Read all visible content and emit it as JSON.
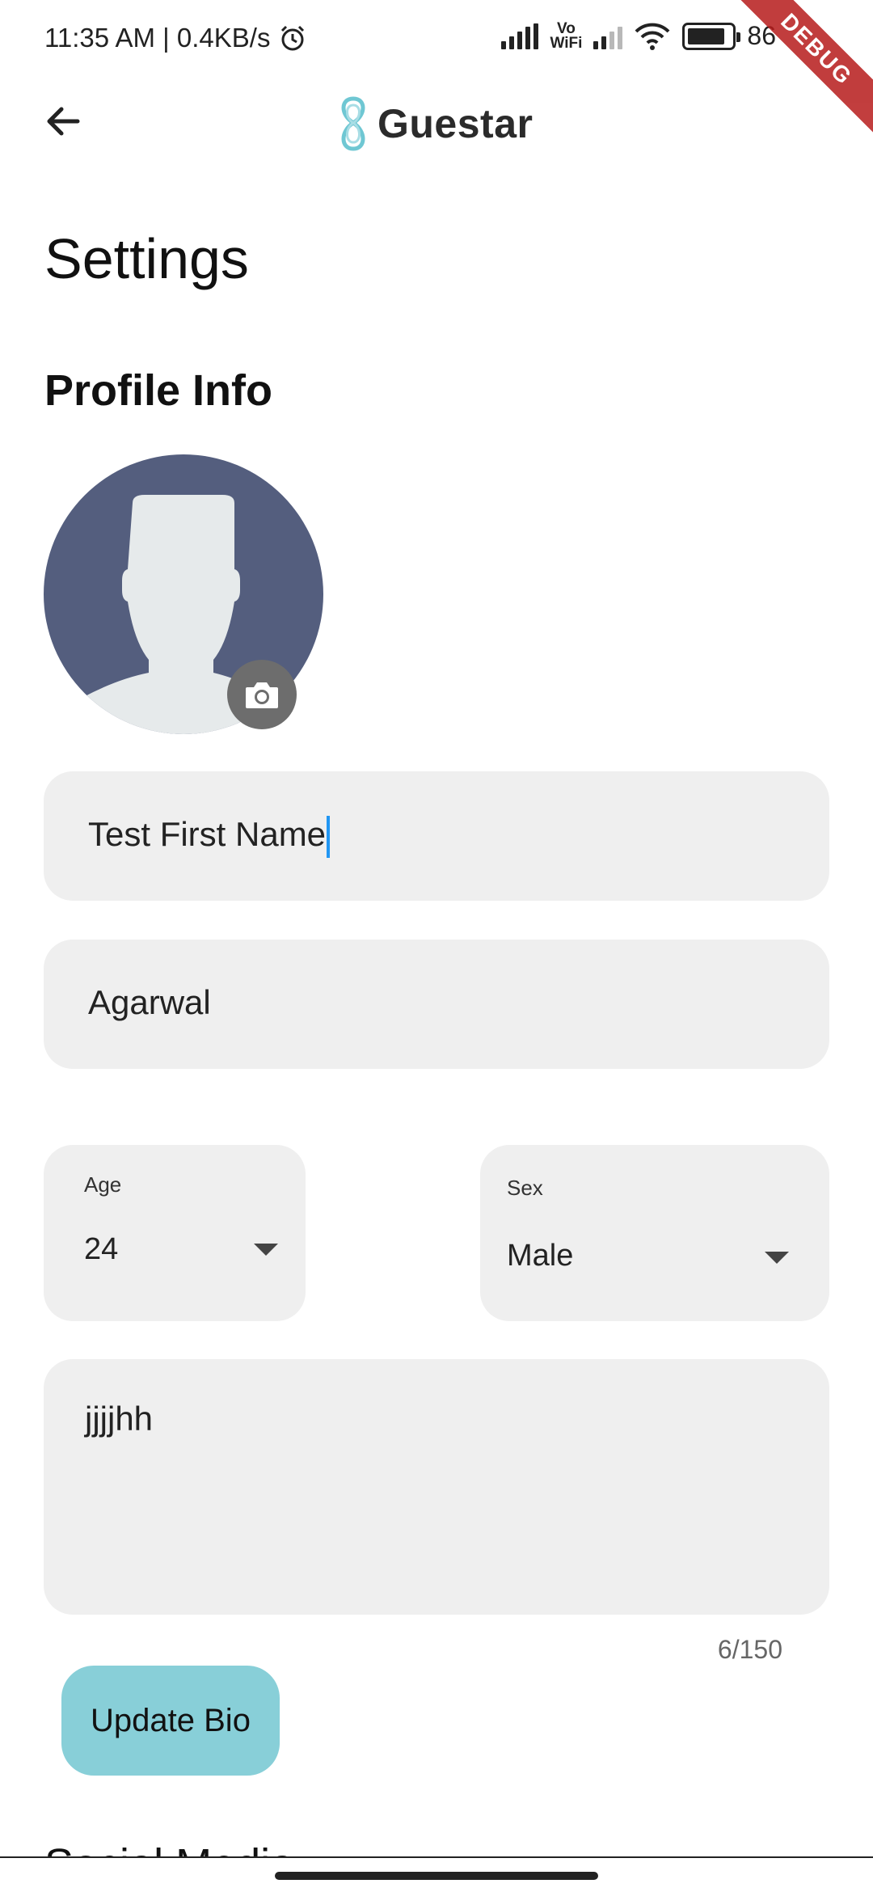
{
  "status_bar": {
    "time": "11:35 AM | 0.4KB/s",
    "vowifi_top": "Vo",
    "vowifi_bottom": "WiFi",
    "battery": "86",
    "battery_level": 0.86,
    "debug_label": "DEBUG"
  },
  "app_bar": {
    "brand": "Guestar",
    "brand_color": "#6fc7d3",
    "back_icon": "arrow-left-icon"
  },
  "page": {
    "title": "Settings",
    "section_profile": "Profile Info",
    "section_next": "Social Media"
  },
  "profile": {
    "avatar_bg": "#545e7e",
    "avatar_fg": "#e6eaeb",
    "camera_icon": "camera-icon",
    "first_name": "Test First Name",
    "last_name": "Agarwal",
    "age_label": "Age",
    "age_value": "24",
    "sex_label": "Sex",
    "sex_value": "Male",
    "bio": "jjjjhh",
    "bio_counter": "6/150",
    "update_button": "Update Bio",
    "accent": "#88cfd8"
  }
}
